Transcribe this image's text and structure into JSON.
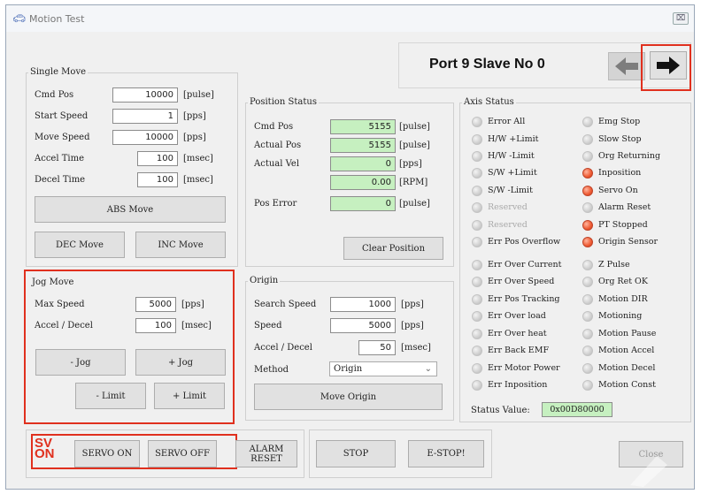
{
  "window": {
    "title": "Motion Test",
    "close_label": "⌧"
  },
  "port": {
    "title": "Port 9 Slave No 0",
    "prev_icon": "arrow-left-icon",
    "next_icon": "arrow-right-icon"
  },
  "single_move": {
    "title": "Single Move",
    "rows": [
      {
        "label": "Cmd Pos",
        "value": "10000",
        "unit": "[pulse]"
      },
      {
        "label": "Start Speed",
        "value": "1",
        "unit": "[pps]"
      },
      {
        "label": "Move Speed",
        "value": "10000",
        "unit": "[pps]"
      },
      {
        "label": "Accel Time",
        "value": "100",
        "unit": "[msec]"
      },
      {
        "label": "Decel Time",
        "value": "100",
        "unit": "[msec]"
      }
    ],
    "abs_move": "ABS Move",
    "dec_move": "DEC Move",
    "inc_move": "INC Move"
  },
  "jog_move": {
    "title": "Jog Move",
    "rows": [
      {
        "label": "Max Speed",
        "value": "5000",
        "unit": "[pps]"
      },
      {
        "label": "Accel / Decel",
        "value": "100",
        "unit": "[msec]"
      }
    ],
    "minus_jog": "- Jog",
    "plus_jog": "+ Jog",
    "minus_limit": "- Limit",
    "plus_limit": "+ Limit"
  },
  "position_status": {
    "title": "Position Status",
    "rows": [
      {
        "label": "Cmd Pos",
        "value": "5155",
        "unit": "[pulse]"
      },
      {
        "label": "Actual Pos",
        "value": "5155",
        "unit": "[pulse]"
      },
      {
        "label": "Actual Vel",
        "value": "0",
        "unit": "[pps]"
      },
      {
        "label": "",
        "value": "0.00",
        "unit": "[RPM]"
      },
      {
        "label": "Pos Error",
        "value": "0",
        "unit": "[pulse]"
      }
    ],
    "clear_position": "Clear Position"
  },
  "origin": {
    "title": "Origin",
    "rows": [
      {
        "label": "Search Speed",
        "value": "1000",
        "unit": "[pps]"
      },
      {
        "label": "Speed",
        "value": "5000",
        "unit": "[pps]"
      },
      {
        "label": "Accel / Decel",
        "value": "50",
        "unit": "[msec]"
      }
    ],
    "method_label": "Method",
    "method_value": "Origin",
    "move_origin": "Move Origin"
  },
  "axis_status": {
    "title": "Axis Status",
    "left": [
      {
        "label": "Error All",
        "on": false,
        "dim": false
      },
      {
        "label": "H/W +Limit",
        "on": false,
        "dim": false
      },
      {
        "label": "H/W -Limit",
        "on": false,
        "dim": false
      },
      {
        "label": "S/W +Limit",
        "on": false,
        "dim": false
      },
      {
        "label": "S/W -Limit",
        "on": false,
        "dim": false
      },
      {
        "label": "Reserved",
        "on": false,
        "dim": true
      },
      {
        "label": "Reserved",
        "on": false,
        "dim": true
      },
      {
        "label": "Err Pos Overflow",
        "on": false,
        "dim": false
      },
      {
        "label": "Err Over Current",
        "on": false,
        "dim": false
      },
      {
        "label": "Err Over Speed",
        "on": false,
        "dim": false
      },
      {
        "label": "Err Pos Tracking",
        "on": false,
        "dim": false
      },
      {
        "label": "Err Over load",
        "on": false,
        "dim": false
      },
      {
        "label": "Err Over heat",
        "on": false,
        "dim": false
      },
      {
        "label": "Err Back EMF",
        "on": false,
        "dim": false
      },
      {
        "label": "Err Motor Power",
        "on": false,
        "dim": false
      },
      {
        "label": "Err Inposition",
        "on": false,
        "dim": false
      }
    ],
    "right": [
      {
        "label": "Emg Stop",
        "on": false,
        "dim": false
      },
      {
        "label": "Slow Stop",
        "on": false,
        "dim": false
      },
      {
        "label": "Org Returning",
        "on": false,
        "dim": false
      },
      {
        "label": "Inposition",
        "on": true,
        "dim": false
      },
      {
        "label": "Servo On",
        "on": true,
        "dim": false
      },
      {
        "label": "Alarm Reset",
        "on": false,
        "dim": false
      },
      {
        "label": "PT Stopped",
        "on": true,
        "dim": false
      },
      {
        "label": "Origin Sensor",
        "on": true,
        "dim": false
      },
      {
        "label": "Z Pulse",
        "on": false,
        "dim": false
      },
      {
        "label": "Org Ret OK",
        "on": false,
        "dim": false
      },
      {
        "label": "Motion DIR",
        "on": false,
        "dim": false
      },
      {
        "label": "Motioning",
        "on": false,
        "dim": false
      },
      {
        "label": "Motion Pause",
        "on": false,
        "dim": false
      },
      {
        "label": "Motion Accel",
        "on": false,
        "dim": false
      },
      {
        "label": "Motion Decel",
        "on": false,
        "dim": false
      },
      {
        "label": "Motion Const",
        "on": false,
        "dim": false
      }
    ],
    "status_label": "Status Value:",
    "status_value": "0x00D80000"
  },
  "bottom": {
    "sv_line1": "SV",
    "sv_line2": "ON",
    "servo_on": "SERVO ON",
    "servo_off": "SERVO OFF",
    "alarm_reset": "ALARM RESET",
    "stop": "STOP",
    "estop": "E-STOP!",
    "close": "Close"
  },
  "colors": {
    "accent_red": "#e0301e",
    "led_on": "#ef5a32",
    "field_green": "#c6f0c0"
  }
}
